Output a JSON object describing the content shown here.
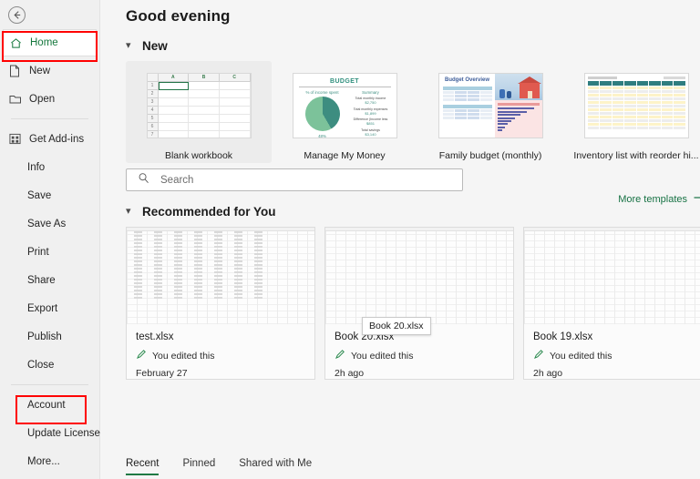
{
  "sidebar": {
    "back_icon": "back-arrow-icon",
    "items": [
      {
        "label": "Home",
        "icon": "home-icon",
        "active": true,
        "indent": false,
        "highlight": true
      },
      {
        "label": "New",
        "icon": "page-icon",
        "active": false,
        "indent": false,
        "highlight": false
      },
      {
        "label": "Open",
        "icon": "folder-icon",
        "active": false,
        "indent": false,
        "highlight": false
      },
      {
        "label": "Get Add-ins",
        "icon": "addins-icon",
        "active": false,
        "indent": false,
        "highlight": false
      },
      {
        "label": "Info",
        "icon": "",
        "active": false,
        "indent": true,
        "highlight": false
      },
      {
        "label": "Save",
        "icon": "",
        "active": false,
        "indent": true,
        "highlight": false
      },
      {
        "label": "Save As",
        "icon": "",
        "active": false,
        "indent": true,
        "highlight": false
      },
      {
        "label": "Print",
        "icon": "",
        "active": false,
        "indent": true,
        "highlight": false
      },
      {
        "label": "Share",
        "icon": "",
        "active": false,
        "indent": true,
        "highlight": false
      },
      {
        "label": "Export",
        "icon": "",
        "active": false,
        "indent": true,
        "highlight": false
      },
      {
        "label": "Publish",
        "icon": "",
        "active": false,
        "indent": true,
        "highlight": false
      },
      {
        "label": "Close",
        "icon": "",
        "active": false,
        "indent": true,
        "highlight": false
      },
      {
        "label": "Account",
        "icon": "",
        "active": false,
        "indent": true,
        "highlight": true
      },
      {
        "label": "Update License",
        "icon": "",
        "active": false,
        "indent": true,
        "highlight": false
      },
      {
        "label": "More...",
        "icon": "",
        "active": false,
        "indent": true,
        "highlight": false
      }
    ]
  },
  "header": {
    "greeting": "Good evening"
  },
  "new_section": {
    "title": "New",
    "chevron": "chevron-down-icon",
    "more_templates": "More templates",
    "more_arrow": "arrow-right-icon",
    "templates": [
      {
        "caption": "Blank workbook",
        "thumb": "blank-workbook",
        "selected": true
      },
      {
        "caption": "Manage My Money",
        "thumb": "budget-pie",
        "selected": false
      },
      {
        "caption": "Family budget (monthly)",
        "thumb": "family-budget",
        "selected": false
      },
      {
        "caption": "Inventory list with reorder hi...",
        "thumb": "inventory-list",
        "selected": false
      }
    ]
  },
  "blank_workbook_thumb": {
    "columns": [
      "A",
      "B",
      "C"
    ],
    "rows": [
      "1",
      "2",
      "3",
      "4",
      "5",
      "6",
      "7"
    ],
    "selected_cell": "A1"
  },
  "budget_thumb": {
    "title": "BUDGET",
    "left_label": "% of income spent",
    "right_label": "Summary",
    "pct": "48%",
    "items": [
      {
        "key": "Total monthly income",
        "value": "$2,750"
      },
      {
        "key": "Total monthly expenses",
        "value": "$1,899"
      },
      {
        "key": "Difference (Income less",
        "value": "$851"
      },
      {
        "key": "Total savings",
        "value": "$3,140"
      }
    ]
  },
  "family_budget_thumb": {
    "title": "Budget Overview"
  },
  "search": {
    "placeholder": "Search",
    "icon": "search-icon"
  },
  "recommended_section": {
    "title": "Recommended for You",
    "chevron": "chevron-down-icon",
    "cards": [
      {
        "name": "test.xlsx",
        "activity": "You edited this",
        "time": "February 27",
        "icon": "pencil-icon",
        "preview": "data-grid"
      },
      {
        "name": "Book 20.xlsx",
        "activity": "You edited this",
        "time": "2h ago",
        "icon": "pencil-icon",
        "preview": "empty-grid"
      },
      {
        "name": "Book 19.xlsx",
        "activity": "You edited this",
        "time": "2h ago",
        "icon": "pencil-icon",
        "preview": "empty-grid"
      }
    ],
    "tooltip": "Book 20.xlsx"
  },
  "bottom_tabs": [
    {
      "label": "Recent",
      "active": true
    },
    {
      "label": "Pinned",
      "active": false
    },
    {
      "label": "Shared with Me",
      "active": false
    }
  ],
  "colors": {
    "accent_green": "#177244",
    "annotation_red": "#ff0000",
    "page_bg": "#f5f5f5",
    "sidebar_bg": "#f0f0f0"
  }
}
